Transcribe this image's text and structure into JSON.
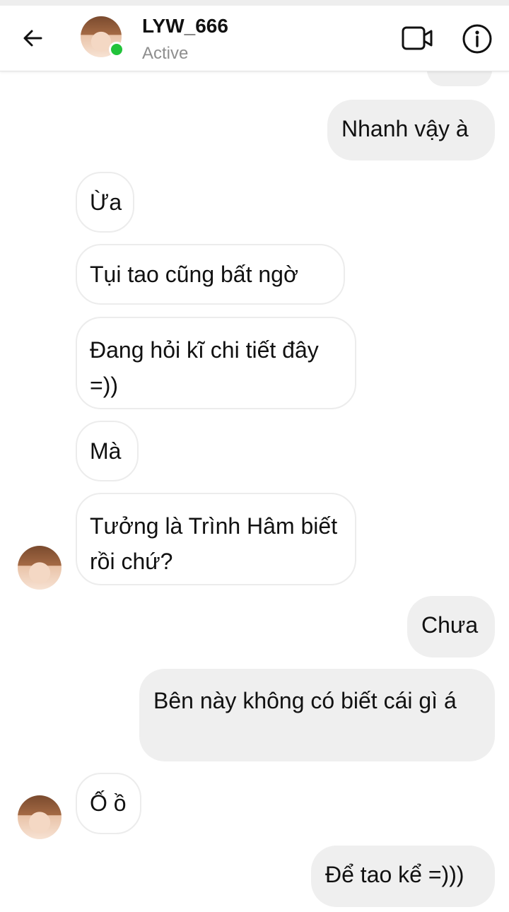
{
  "header": {
    "name": "LYW_666",
    "status": "Active",
    "back_icon": "arrow-left-icon",
    "video_icon": "video-camera-icon",
    "info_icon": "info-icon",
    "online_color": "#22c33a"
  },
  "messages": [
    {
      "from": "me",
      "text": "Nhanh vậy à"
    },
    {
      "from": "them",
      "text": "Ừa"
    },
    {
      "from": "them",
      "text": "Tụi tao cũng bất ngờ"
    },
    {
      "from": "them",
      "text": "Đang hỏi kĩ chi tiết đây =))"
    },
    {
      "from": "them",
      "text": "Mà"
    },
    {
      "from": "them",
      "text": "Tưởng là Trình Hâm biết rồi chứ?"
    },
    {
      "from": "me",
      "text": "Chưa"
    },
    {
      "from": "me",
      "text": "Bên này không có biết cái gì á"
    },
    {
      "from": "them",
      "text": "Ố ồ"
    },
    {
      "from": "me",
      "text": "Để tao kể =)))"
    }
  ],
  "colors": {
    "outgoing_bubble": "#efefef",
    "incoming_border": "#ececec",
    "status_text": "#8e8e8e"
  }
}
